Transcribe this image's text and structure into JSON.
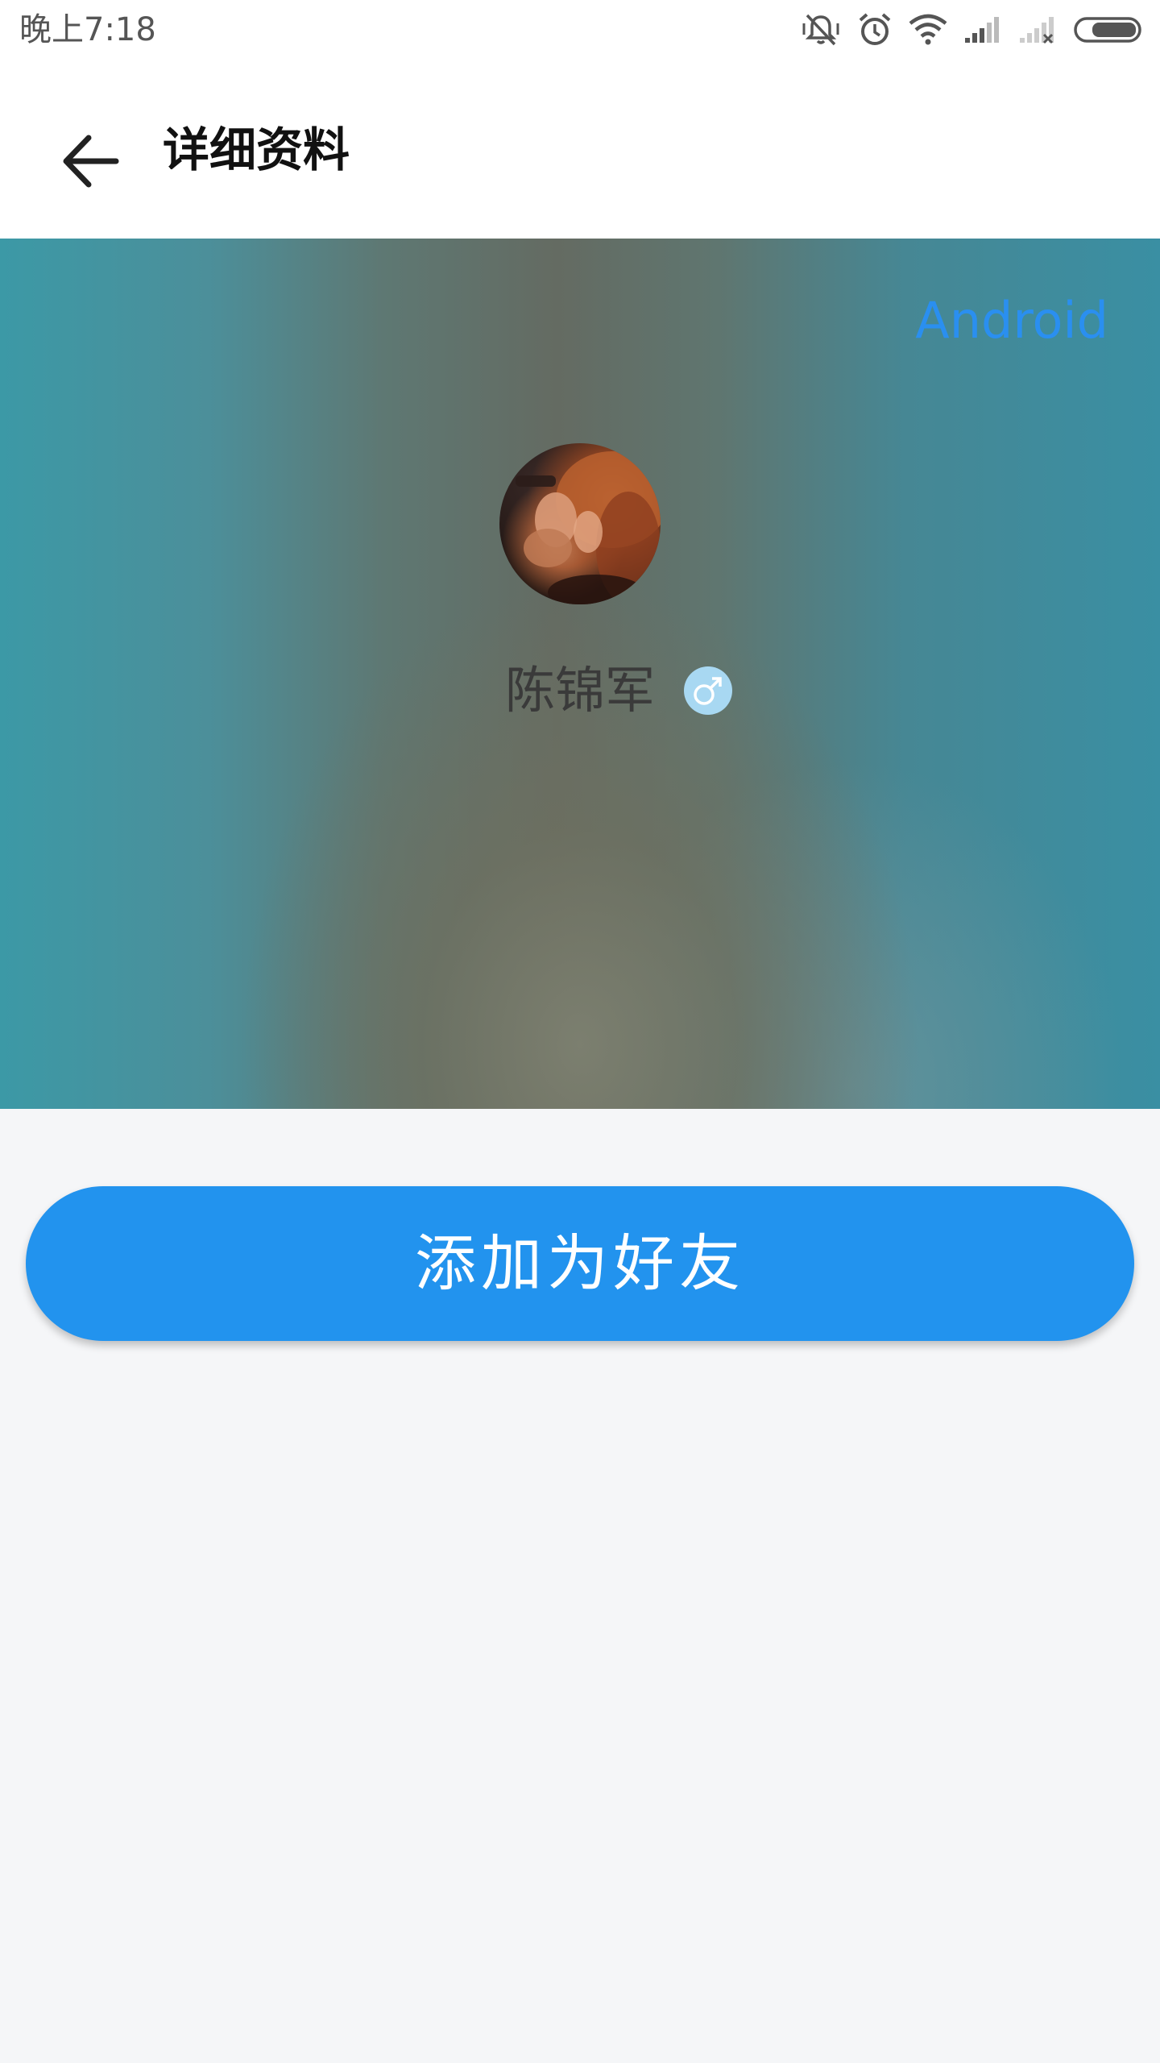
{
  "status_bar": {
    "time": "晚上7:18",
    "icons": [
      "mute-vibrate-icon",
      "alarm-icon",
      "wifi-icon",
      "signal-icon",
      "signal-off-icon",
      "battery-icon"
    ]
  },
  "app_bar": {
    "back_icon": "arrow-left-icon",
    "title": "详细资料"
  },
  "profile": {
    "platform": "Android",
    "name": "陈锦军",
    "gender_symbol": "♂",
    "gender_icon": "male-icon"
  },
  "actions": {
    "add_friend_label": "添加为好友"
  },
  "colors": {
    "accent": "#2293ee",
    "platform_text": "#2a8ff0",
    "gender_badge": "#a8d8f2",
    "background": "#f5f6f8"
  }
}
